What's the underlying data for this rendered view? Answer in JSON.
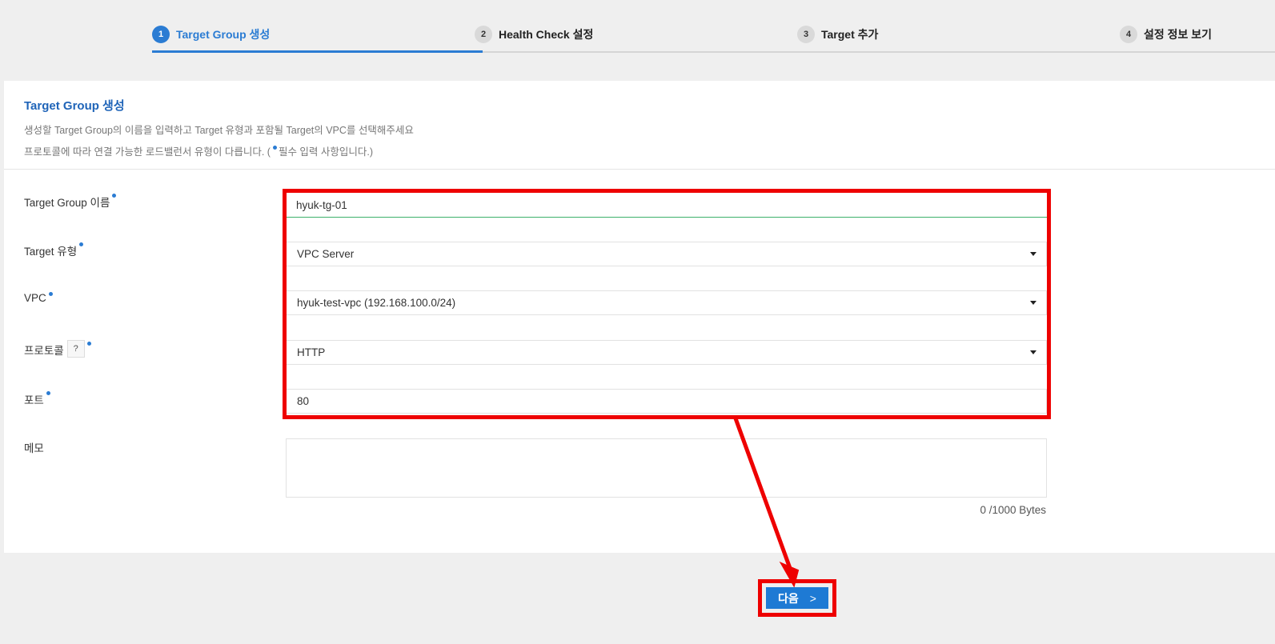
{
  "stepper": {
    "steps": [
      {
        "num": "1",
        "label": "Target Group 생성"
      },
      {
        "num": "2",
        "label": "Health Check 설정"
      },
      {
        "num": "3",
        "label": "Target 추가"
      },
      {
        "num": "4",
        "label": "설정 정보 보기"
      }
    ],
    "active_step": 1
  },
  "panel": {
    "title": "Target Group 생성",
    "desc_line1": "생성할 Target Group의 이름을 입력하고 Target 유형과 포함될 Target의 VPC를 선택해주세요",
    "desc_line2_pre": "프로토콜에 따라 연결 가능한 로드밸런서 유형이 다릅니다. (",
    "desc_line2_post": "필수 입력 사항입니다.)"
  },
  "form": {
    "name_label": "Target Group 이름",
    "name_value": "hyuk-tg-01",
    "type_label": "Target 유형",
    "type_value": "VPC Server",
    "vpc_label": "VPC",
    "vpc_value": "hyuk-test-vpc (192.168.100.0/24)",
    "protocol_label": "프로토콜",
    "protocol_help": "?",
    "protocol_value": "HTTP",
    "port_label": "포트",
    "port_value": "80",
    "memo_label": "메모",
    "memo_value": "",
    "byte_count": "0 /1000 Bytes"
  },
  "actions": {
    "next_label": "다음",
    "next_chevron": ">"
  },
  "colors": {
    "accent": "#2b7cd3",
    "highlight": "#ee0000",
    "valid": "#3db16b"
  }
}
